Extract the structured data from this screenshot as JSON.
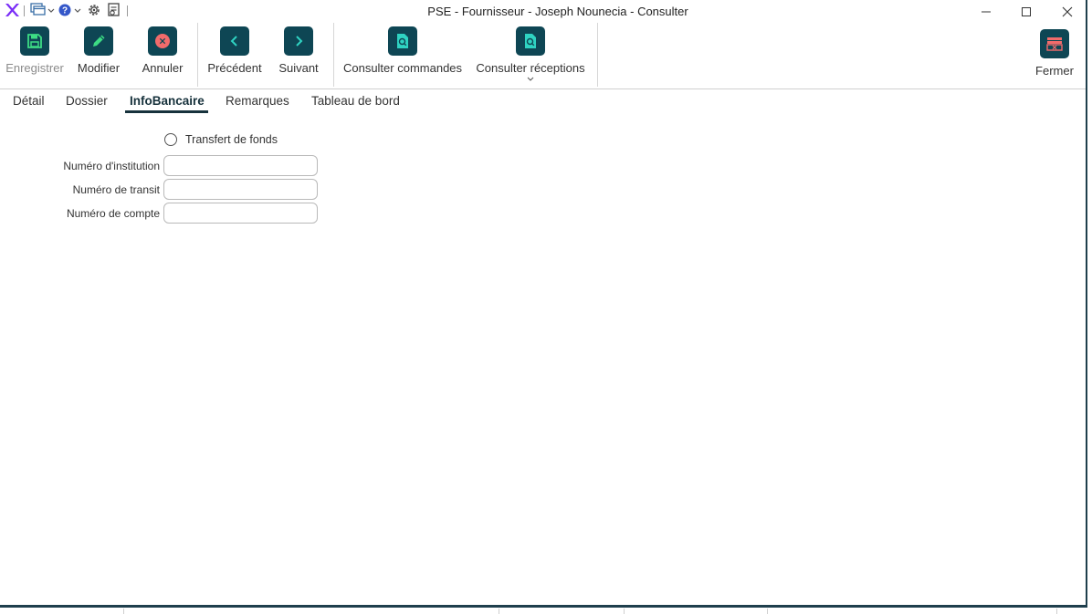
{
  "window": {
    "title": "PSE - Fournisseur - Joseph Nounecia - Consulter"
  },
  "quick_access": {
    "logo_icon": "app-logo-x",
    "windows_icon": "windows-stack-icon",
    "help_icon": "help-icon",
    "settings_icon": "gear-icon",
    "document_icon": "document-icon"
  },
  "ribbon": {
    "save_label": "Enregistrer",
    "modify_label": "Modifier",
    "cancel_label": "Annuler",
    "previous_label": "Précédent",
    "next_label": "Suivant",
    "orders_label": "Consulter commandes",
    "receptions_label": "Consulter réceptions",
    "close_label": "Fermer"
  },
  "tabs": [
    {
      "label": "Détail",
      "active": false
    },
    {
      "label": "Dossier",
      "active": false
    },
    {
      "label": "InfoBancaire",
      "active": true
    },
    {
      "label": "Remarques",
      "active": false
    },
    {
      "label": "Tableau de bord",
      "active": false
    }
  ],
  "form": {
    "transfer_label": "Transfert de fonds",
    "transfer_checked": false,
    "institution_label": "Numéro d'institution",
    "institution_value": "",
    "transit_label": "Numéro de transit",
    "transit_value": "",
    "account_label": "Numéro de compte",
    "account_value": ""
  },
  "colors": {
    "accent": "#0e4654",
    "icon_green": "#3ddc84",
    "icon_red": "#f26b6b",
    "icon_teal": "#2fd3c2",
    "logo_purple": "#7b2ff7"
  }
}
